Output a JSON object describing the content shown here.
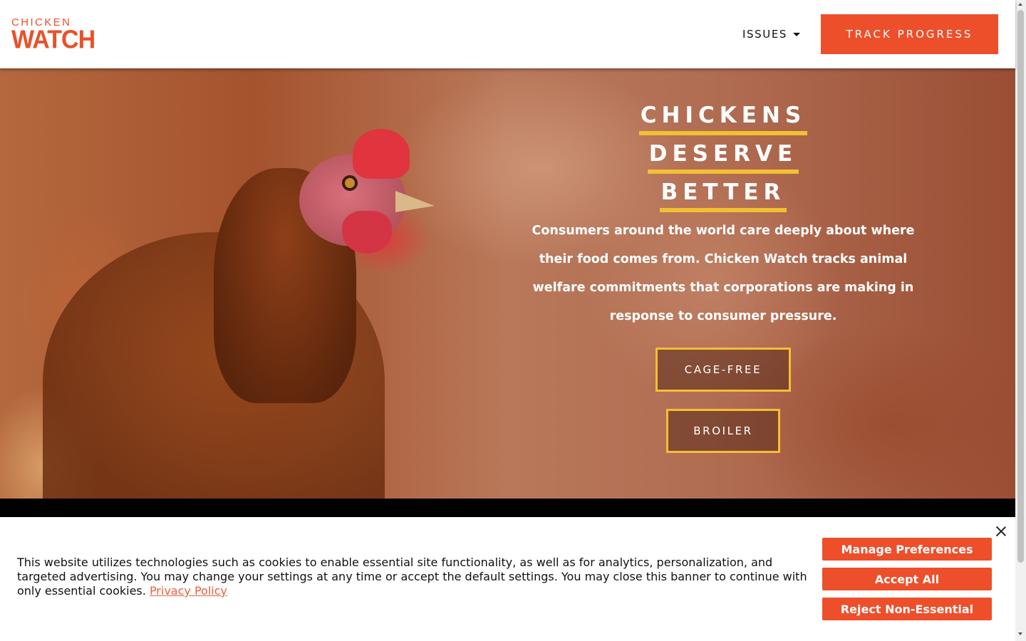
{
  "header": {
    "logo": {
      "line1": "CHICKEN",
      "line2": "WATCH"
    },
    "nav": {
      "issues_label": "ISSUES",
      "issues_icon": "caret-down-icon"
    },
    "track_button": "TRACK PROGRESS"
  },
  "hero": {
    "headline": [
      "CHICKENS",
      "DESERVE",
      "BETTER"
    ],
    "description": "Consumers around the world care deeply about where their food comes from. Chicken Watch tracks animal welfare commitments that corporations are making in response to consumer pressure.",
    "buttons": {
      "cage_free": "CAGE-FREE",
      "broiler": "BROILER"
    }
  },
  "cookie_banner": {
    "text": "This website utilizes technologies such as cookies to enable essential site functionality, as well as for analytics, personalization, and targeted advertising. You may change your settings at any time or accept the default settings. You may close this banner to continue with only essential cookies.",
    "privacy_link": "Privacy Policy",
    "buttons": {
      "manage": "Manage Preferences",
      "accept": "Accept All",
      "reject": "Reject Non-Essential"
    },
    "close_icon": "close-icon"
  },
  "colors": {
    "brand": "#ed4f2b",
    "accent_yellow": "#f3bf35",
    "link": "#e8603d"
  }
}
